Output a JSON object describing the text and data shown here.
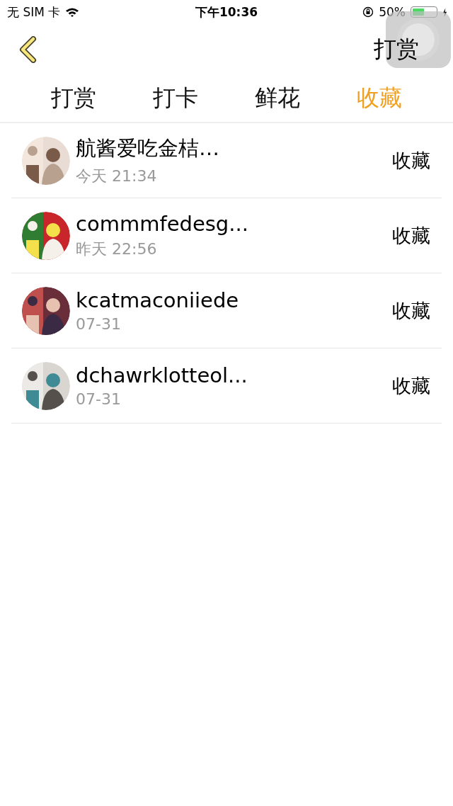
{
  "status_bar": {
    "carrier": "无 SIM 卡",
    "time": "下午10:36",
    "battery": "50%"
  },
  "nav": {
    "title": "打赏"
  },
  "tabs": [
    {
      "label": "打赏",
      "selected": false
    },
    {
      "label": "打卡",
      "selected": false
    },
    {
      "label": "鲜花",
      "selected": false
    },
    {
      "label": "收藏",
      "selected": true
    }
  ],
  "rows": [
    {
      "name": "航酱爱吃金桔…",
      "time": "今天 21:34",
      "action": "收藏"
    },
    {
      "name": "commmfedesg...",
      "time": "昨天 22:56",
      "action": "收藏"
    },
    {
      "name": "kcatmaconiiede",
      "time": "07-31",
      "action": "收藏"
    },
    {
      "name": "dchawrklotteol...",
      "time": "07-31",
      "action": "收藏"
    }
  ]
}
